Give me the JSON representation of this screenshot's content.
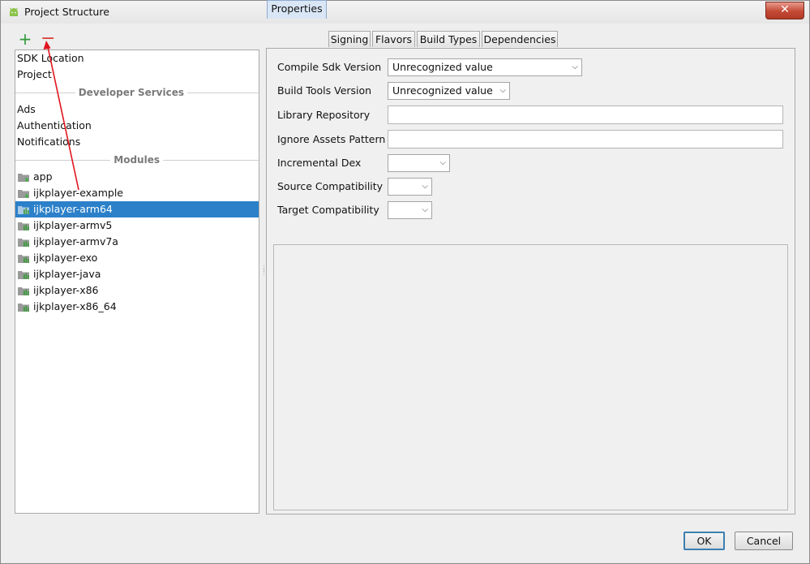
{
  "window": {
    "title": "Project Structure",
    "close": "✕"
  },
  "toolbar": {
    "add": "+",
    "remove": "−"
  },
  "sidebar": {
    "top_items": [
      "SDK Location",
      "Project"
    ],
    "sections": {
      "developer_services": "Developer Services",
      "modules": "Modules"
    },
    "services": [
      "Ads",
      "Authentication",
      "Notifications"
    ],
    "modules": [
      "app",
      "ijkplayer-example",
      "ijkplayer-arm64",
      "ijkplayer-armv5",
      "ijkplayer-armv7a",
      "ijkplayer-exo",
      "ijkplayer-java",
      "ijkplayer-x86",
      "ijkplayer-x86_64"
    ],
    "selected_module": "ijkplayer-arm64"
  },
  "tabs": [
    "Properties",
    "Signing",
    "Flavors",
    "Build Types",
    "Dependencies"
  ],
  "active_tab": "Properties",
  "properties": {
    "compile_sdk_label": "Compile Sdk Version",
    "compile_sdk_value": "Unrecognized value",
    "build_tools_label": "Build Tools Version",
    "build_tools_value": "Unrecognized value",
    "library_repo_label": "Library Repository",
    "library_repo_value": "",
    "ignore_assets_label": "Ignore Assets Pattern",
    "ignore_assets_value": "",
    "incremental_dex_label": "Incremental Dex",
    "incremental_dex_value": "",
    "source_compat_label": "Source Compatibility",
    "source_compat_value": "",
    "target_compat_label": "Target Compatibility",
    "target_compat_value": ""
  },
  "buttons": {
    "ok": "OK",
    "cancel": "Cancel"
  },
  "colors": {
    "selection": "#2b80c9",
    "annotation_arrow": "#e0141e",
    "add": "#2f9a3a",
    "remove": "#d8413a"
  }
}
